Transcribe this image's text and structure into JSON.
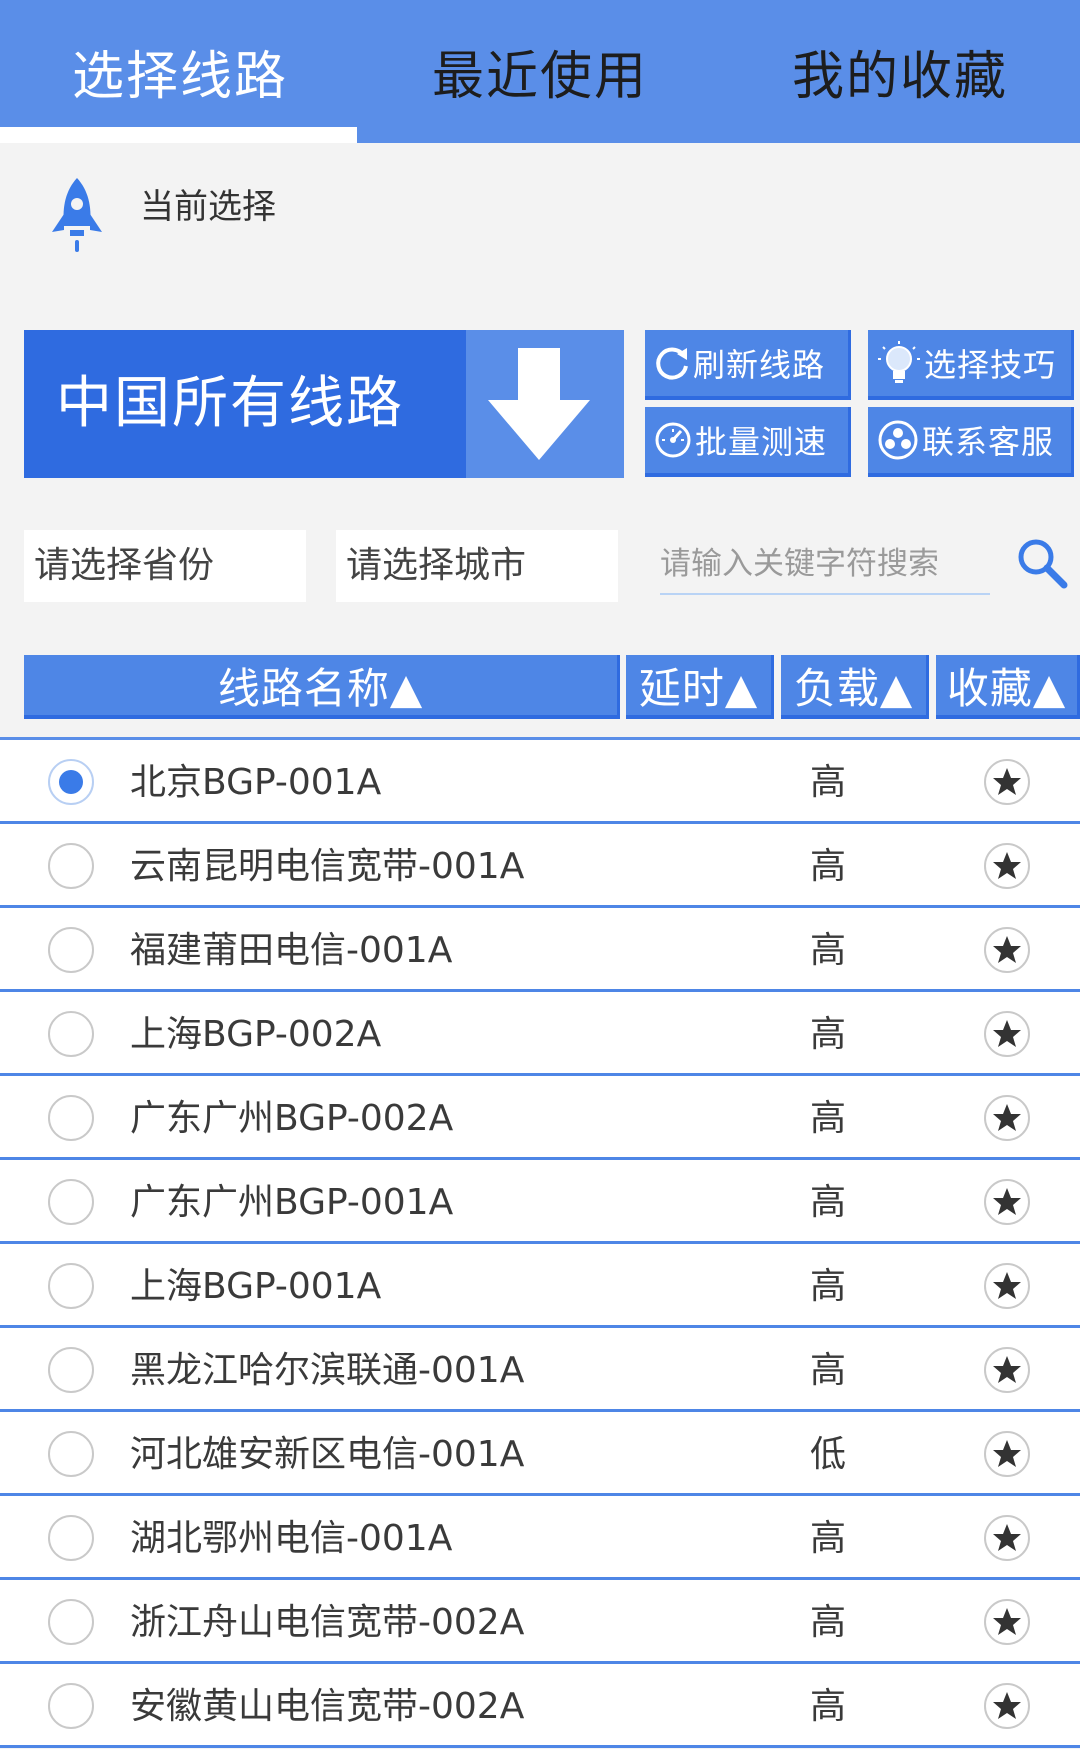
{
  "tabs": [
    {
      "label": "选择线路",
      "active": true
    },
    {
      "label": "最近使用",
      "active": false
    },
    {
      "label": "我的收藏",
      "active": false
    }
  ],
  "current": {
    "label": "当前选择",
    "icon": "rocket-icon"
  },
  "region_select": {
    "label": "中国所有线路",
    "icon": "arrow-down-icon"
  },
  "tools": [
    {
      "label": "刷新线路",
      "icon": "refresh-icon"
    },
    {
      "label": "选择技巧",
      "icon": "lightbulb-icon"
    },
    {
      "label": "批量测速",
      "icon": "speedometer-icon"
    },
    {
      "label": "联系客服",
      "icon": "support-icon"
    }
  ],
  "filters": {
    "province_placeholder": "请选择省份",
    "city_placeholder": "请选择城市",
    "search_placeholder": "请输入关键字符搜索"
  },
  "table": {
    "headers": [
      "线路名称▲",
      "延时▲",
      "负载▲",
      "收藏▲"
    ],
    "rows": [
      {
        "name": "北京BGP-001A",
        "load": "高",
        "selected": true
      },
      {
        "name": "云南昆明电信宽带-001A",
        "load": "高",
        "selected": false
      },
      {
        "name": "福建莆田电信-001A",
        "load": "高",
        "selected": false
      },
      {
        "name": "上海BGP-002A",
        "load": "高",
        "selected": false
      },
      {
        "name": "广东广州BGP-002A",
        "load": "高",
        "selected": false
      },
      {
        "name": "广东广州BGP-001A",
        "load": "高",
        "selected": false
      },
      {
        "name": "上海BGP-001A",
        "load": "高",
        "selected": false
      },
      {
        "name": "黑龙江哈尔滨联通-001A",
        "load": "高",
        "selected": false
      },
      {
        "name": "河北雄安新区电信-001A",
        "load": "低",
        "selected": false
      },
      {
        "name": "湖北鄂州电信-001A",
        "load": "高",
        "selected": false
      },
      {
        "name": "浙江舟山电信宽带-002A",
        "load": "高",
        "selected": false
      },
      {
        "name": "安徽黄山电信宽带-002A",
        "load": "高",
        "selected": false
      }
    ]
  },
  "colors": {
    "primary": "#5a8ee8",
    "dark": "#2f6be0",
    "radio": "#3a7be8"
  }
}
